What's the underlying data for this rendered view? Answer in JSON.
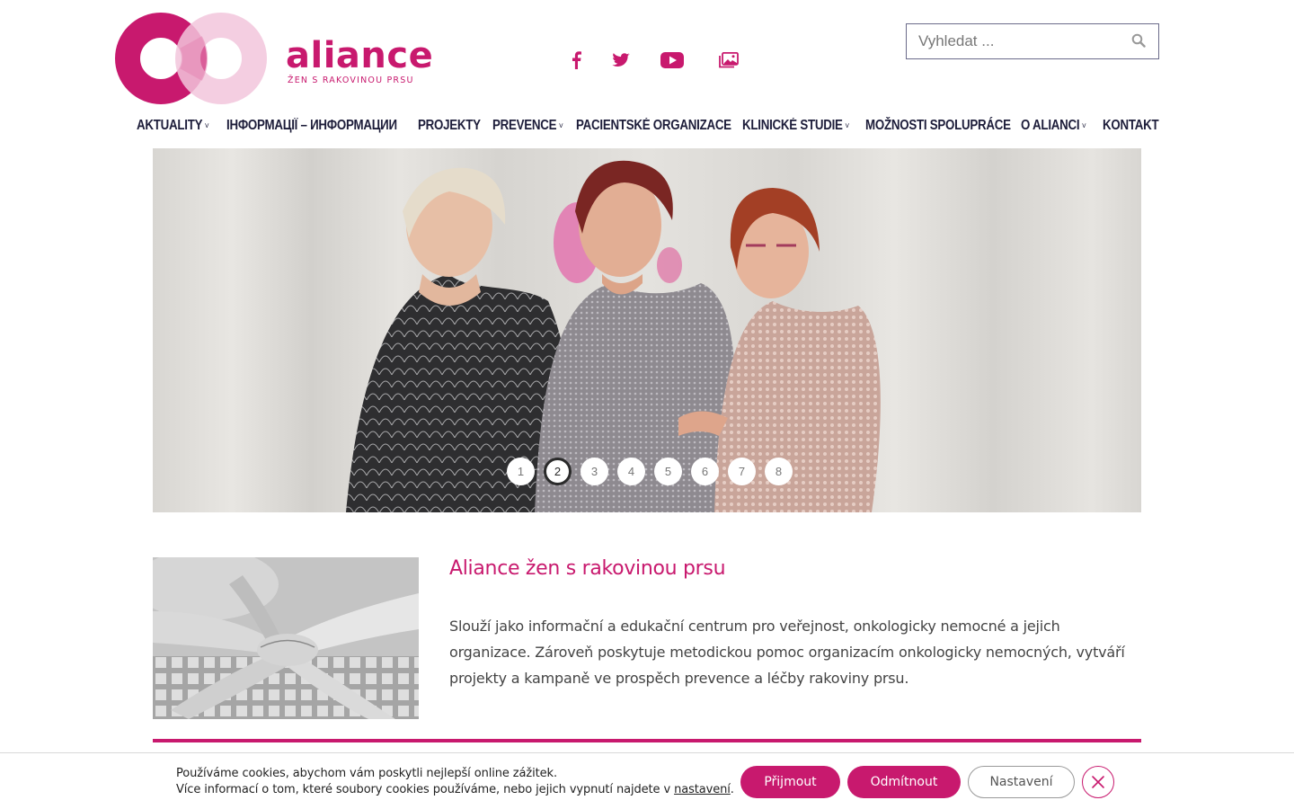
{
  "brand": {
    "name": "aliance",
    "tagline": "ŽEN S RAKOVINOU PRSU",
    "color": "#c8196e"
  },
  "social": [
    {
      "icon": "facebook-icon"
    },
    {
      "icon": "twitter-icon"
    },
    {
      "icon": "youtube-icon"
    },
    {
      "icon": "gallery-icon"
    }
  ],
  "search": {
    "placeholder": "Vyhledat ...",
    "icon": "search-icon"
  },
  "nav": {
    "items": [
      {
        "label": "AKTUALITY",
        "dropdown": true
      },
      {
        "label": "ІНФОРМАЦІЇ – ИНФОРМАЦИИ",
        "dropdown": false
      },
      {
        "label": "PROJEKTY",
        "dropdown": false
      },
      {
        "label": "PREVENCE",
        "dropdown": true
      },
      {
        "label": "PACIENTSKÉ ORGANIZACE",
        "dropdown": false
      },
      {
        "label": "KLINICKÉ STUDIE",
        "dropdown": true
      },
      {
        "label": "MOŽNOSTI SPOLUPRÁCE",
        "dropdown": false
      },
      {
        "label": "O ALIANCI",
        "dropdown": true
      },
      {
        "label": "KONTAKT",
        "dropdown": false
      }
    ],
    "chevron": "˅"
  },
  "slider": {
    "dots": [
      "1",
      "2",
      "3",
      "4",
      "5",
      "6",
      "7",
      "8"
    ],
    "active": "2"
  },
  "about": {
    "title": "Aliance žen s rakovinou prsu",
    "text": "Slouží jako informační a edukační centrum pro veřejnost, onkologicky nemocné a jejich organizace. Zároveň poskytuje metodickou pomoc organizacím onkologicky nemocných, vytváří projekty a kampaně ve prospěch prevence a léčby rakoviny prsu."
  },
  "cookie": {
    "line1": "Používáme cookies, abychom vám poskytli nejlepší online zážitek.",
    "line2_prefix": "Více informací o tom, které soubory cookies používáme, nebo jejich vypnutí najdete v ",
    "line2_link": "nastavení",
    "line2_suffix": ".",
    "accept": "Přijmout",
    "reject": "Odmítnout",
    "settings": "Nastavení"
  }
}
